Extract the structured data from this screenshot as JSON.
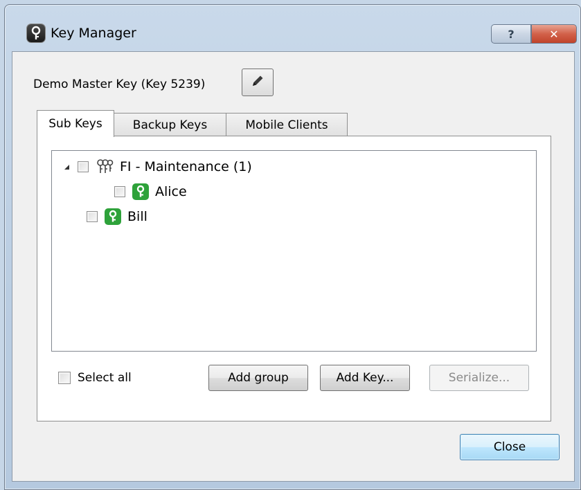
{
  "window": {
    "title": "Key Manager",
    "help_glyph": "?",
    "close_glyph": "✕"
  },
  "master": {
    "label": "Demo Master Key (Key 5239)"
  },
  "tabs": [
    {
      "label": "Sub Keys",
      "active": true
    },
    {
      "label": "Backup Keys",
      "active": false
    },
    {
      "label": "Mobile Clients",
      "active": false
    }
  ],
  "tree": {
    "items": [
      {
        "label": "FI - Maintenance (1)",
        "type": "group",
        "expanded": true,
        "checked": false
      },
      {
        "label": "Alice",
        "type": "key",
        "checked": false
      },
      {
        "label": "Bill",
        "type": "key",
        "checked": false
      }
    ]
  },
  "select_all": {
    "label": "Select all",
    "checked": false
  },
  "buttons": {
    "add_group": "Add group",
    "add_key": "Add Key...",
    "serialize": "Serialize...",
    "close": "Close"
  },
  "colors": {
    "titlebar": "#bacde2",
    "key_icon": "#2ea23a",
    "close_caption": "#c0432b",
    "default_button": "#a7d9f5"
  },
  "icons": {
    "app": "key-icon",
    "edit": "pencil-icon",
    "group": "key-ring-icon",
    "sub_key": "green-key-icon",
    "expander": "triangle-expanded-icon"
  }
}
